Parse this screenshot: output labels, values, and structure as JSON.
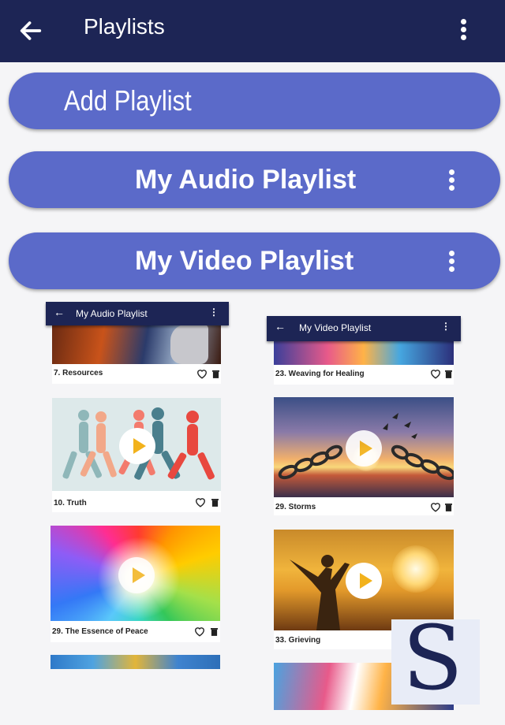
{
  "appbar": {
    "title": "Playlists",
    "back_icon": "arrow-left-icon",
    "menu_icon": "more-vert-icon"
  },
  "buttons": {
    "add": "Add Playlist",
    "audio": "My Audio Playlist",
    "video": "My Video Playlist"
  },
  "audio_screenshot": {
    "bar_title": "My Audio Playlist",
    "cards": [
      "7. Resources",
      "10. Truth",
      "29. The Essence of Peace"
    ]
  },
  "video_screenshot": {
    "bar_title": "My Video Playlist",
    "cards": [
      "23. Weaving for Healing",
      "29. Storms",
      "33. Grieving"
    ]
  },
  "logo_letter": "S",
  "colors": {
    "appbar": "#1d2555",
    "button": "#5b6ac9",
    "background": "#f5f5f7",
    "play": "#f2b21c"
  }
}
